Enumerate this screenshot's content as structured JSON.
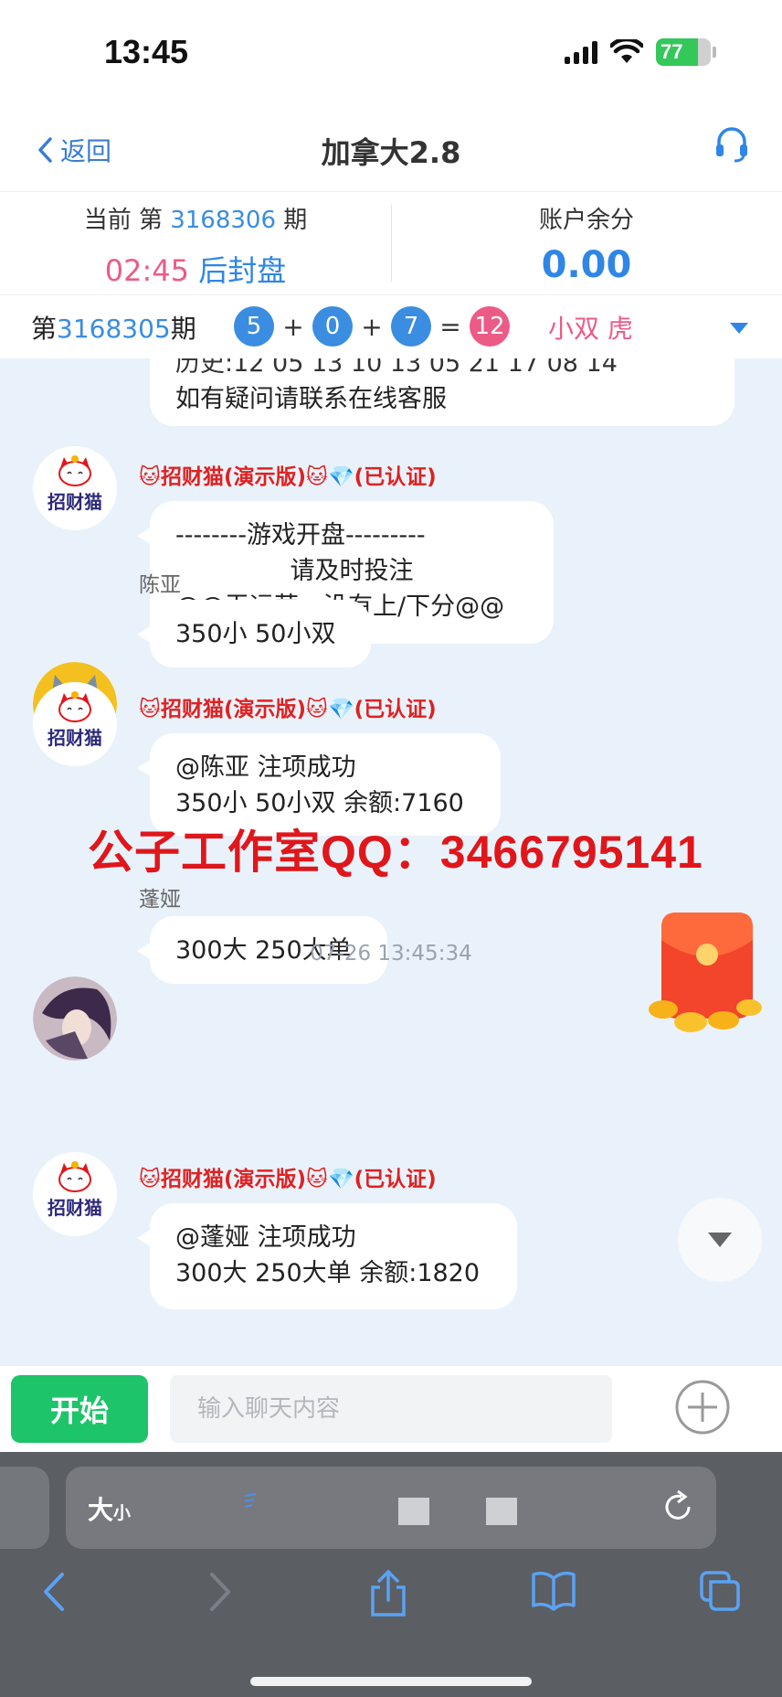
{
  "status_bar": {
    "time": "13:45",
    "battery": "77",
    "battery_level": 0.77
  },
  "header": {
    "back_label": "返回",
    "title": "加拿大2.8",
    "support_icon": "headset-icon"
  },
  "period_info": {
    "current_prefix": "当前 第",
    "current_period": "3168306",
    "current_suffix": "期",
    "countdown": "02:45",
    "status": "后封盘",
    "balance_label": "账户余分",
    "balance": "0.00"
  },
  "last_result": {
    "prefix": "第",
    "period": "3168305",
    "suffix": "期",
    "numbers": [
      "5",
      "0",
      "7"
    ],
    "plus": "+",
    "equals": "=",
    "sum": "12",
    "tags": "小双 虎"
  },
  "chat": {
    "messages": [
      {
        "partial_line1": "历史:12 05 13 10 13 05 21 17 08 14",
        "line2": "如有疑问请联系在线客服"
      },
      {
        "sender": "🐱招财猫(演示版)🐱💎(已认证)",
        "line1": "--------游戏开盘---------",
        "line2": "请及时投注",
        "line3": "@@无运营。没有上/下分@@"
      },
      {
        "sender": "陈亚",
        "line1": "350小 50小双"
      },
      {
        "sender": "🐱招财猫(演示版)🐱💎(已认证)",
        "line1": "@陈亚 注项成功",
        "line2": "350小 50小双 余额:7160"
      },
      {
        "sender": "蓬娅",
        "line1": "300大 250大单"
      },
      {
        "sender": "🐱招财猫(演示版)🐱💎(已认证)",
        "line1": "@蓬娅 注项成功",
        "line2": "300大 250大单 余额:1820"
      }
    ],
    "timestamp": "07-26 13:45:34",
    "bot_avatar_text": "招财猫",
    "watermark": "公子工作室QQ：3466795141"
  },
  "input_bar": {
    "start_label": "开始",
    "placeholder": "输入聊天内容"
  },
  "browser": {
    "aa_big": "大",
    "aa_small": "小"
  },
  "colors": {
    "blue": "#3a8de0",
    "pink": "#ec5b86",
    "green": "#1dc46a",
    "bot_red": "#e02020"
  }
}
